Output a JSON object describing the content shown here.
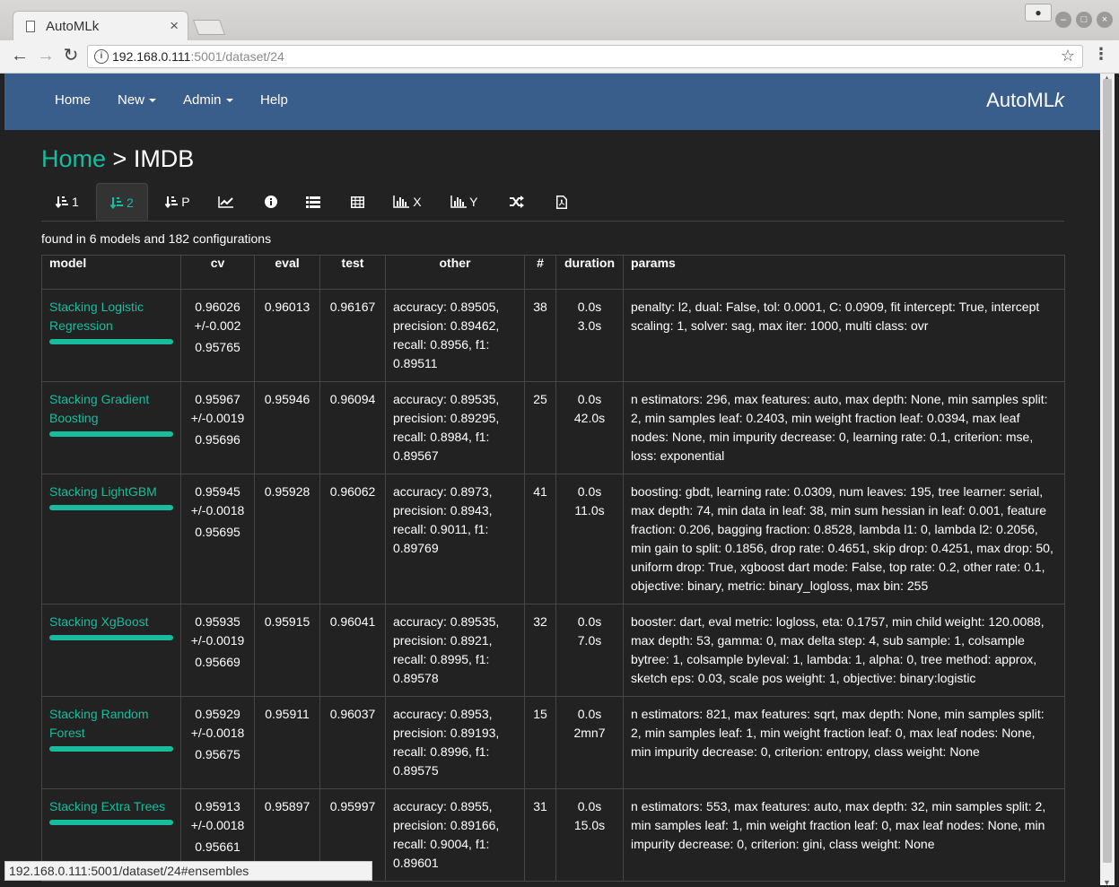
{
  "browser": {
    "tab_title": "AutoMLk",
    "tab_close": "×",
    "url_host": "192.168.0.111",
    "url_rest": ":5001/dataset/24",
    "status_url": "192.168.0.111:5001/dataset/24#ensembles",
    "back": "←",
    "forward": "→",
    "reload": "↻",
    "star": "☆",
    "menu": "⋮"
  },
  "navbar": {
    "items": [
      {
        "label": "Home"
      },
      {
        "label": "New"
      },
      {
        "label": "Admin"
      },
      {
        "label": "Help"
      }
    ],
    "brand_main": "AutoML",
    "brand_italic": "k"
  },
  "breadcrumb": {
    "home": "Home",
    "sep": " > ",
    "current": "IMDB"
  },
  "tabs": [
    {
      "icon": "sort-asc-icon",
      "label": "1"
    },
    {
      "icon": "sort-asc-icon",
      "label": "2",
      "active": true
    },
    {
      "icon": "sort-asc-icon",
      "label": "P"
    },
    {
      "icon": "line-chart-icon",
      "label": ""
    },
    {
      "icon": "info-icon",
      "label": ""
    },
    {
      "icon": "list-icon",
      "label": ""
    },
    {
      "icon": "table-icon",
      "label": ""
    },
    {
      "icon": "bar-chart-icon",
      "label": "X"
    },
    {
      "icon": "bar-chart-icon",
      "label": "Y"
    },
    {
      "icon": "shuffle-icon",
      "label": ""
    },
    {
      "icon": "pdf-icon",
      "label": ""
    }
  ],
  "found_text": "found in 6 models and 182 configurations",
  "table": {
    "headers": [
      "model",
      "cv",
      "eval",
      "test",
      "other",
      "#",
      "duration",
      "params"
    ],
    "rows": [
      {
        "model": "Stacking Logistic Regression",
        "cv": "0.96026",
        "cv_std": "+/-0.002",
        "cv_low": "0.95765",
        "eval": "0.96013",
        "test": "0.96167",
        "other": "accuracy: 0.89505, precision: 0.89462, recall: 0.8956, f1: 0.89511",
        "num": "38",
        "duration1": "0.0s",
        "duration2": "3.0s",
        "params": "penalty: l2, dual: False, tol: 0.0001, C: 0.0909, fit intercept: True, intercept scaling: 1, solver: sag, max iter: 1000, multi class: ovr"
      },
      {
        "model": "Stacking Gradient Boosting",
        "cv": "0.95967",
        "cv_std": "+/-0.0019",
        "cv_low": "0.95696",
        "eval": "0.95946",
        "test": "0.96094",
        "other": "accuracy: 0.89535, precision: 0.89295, recall: 0.8984, f1: 0.89567",
        "num": "25",
        "duration1": "0.0s",
        "duration2": "42.0s",
        "params": "n estimators: 296, max features: auto, max depth: None, min samples split: 2, min samples leaf: 0.2403, min weight fraction leaf: 0.0394, max leaf nodes: None, min impurity decrease: 0, learning rate: 0.1, criterion: mse, loss: exponential"
      },
      {
        "model": "Stacking LightGBM",
        "cv": "0.95945",
        "cv_std": "+/-0.0018",
        "cv_low": "0.95695",
        "eval": "0.95928",
        "test": "0.96062",
        "other": "accuracy: 0.8973, precision: 0.8943, recall: 0.9011, f1: 0.89769",
        "num": "41",
        "duration1": "0.0s",
        "duration2": "11.0s",
        "params": "boosting: gbdt, learning rate: 0.0309, num leaves: 195, tree learner: serial, max depth: 74, min data in leaf: 38, min sum hessian in leaf: 0.001, feature fraction: 0.206, bagging fraction: 0.8528, lambda l1: 0, lambda l2: 0.2056, min gain to split: 0.1856, drop rate: 0.4651, skip drop: 0.4251, max drop: 50, uniform drop: True, xgboost dart mode: False, top rate: 0.2, other rate: 0.1, objective: binary, metric: binary_logloss, max bin: 255"
      },
      {
        "model": "Stacking XgBoost",
        "cv": "0.95935",
        "cv_std": "+/-0.0019",
        "cv_low": "0.95669",
        "eval": "0.95915",
        "test": "0.96041",
        "other": "accuracy: 0.89535, precision: 0.8921, recall: 0.8995, f1: 0.89578",
        "num": "32",
        "duration1": "0.0s",
        "duration2": "7.0s",
        "params": "booster: dart, eval metric: logloss, eta: 0.1757, min child weight: 120.0088, max depth: 53, gamma: 0, max delta step: 4, sub sample: 1, colsample bytree: 1, colsample byleval: 1, lambda: 1, alpha: 0, tree method: approx, sketch eps: 0.03, scale pos weight: 1, objective: binary:logistic"
      },
      {
        "model": "Stacking Random Forest",
        "cv": "0.95929",
        "cv_std": "+/-0.0018",
        "cv_low": "0.95675",
        "eval": "0.95911",
        "test": "0.96037",
        "other": "accuracy: 0.8953, precision: 0.89193, recall: 0.8996, f1: 0.89575",
        "num": "15",
        "duration1": "0.0s",
        "duration2": "2mn7",
        "params": "n estimators: 821, max features: sqrt, max depth: None, min samples split: 2, min samples leaf: 1, min weight fraction leaf: 0, max leaf nodes: None, min impurity decrease: 0, criterion: entropy, class weight: None"
      },
      {
        "model": "Stacking Extra Trees",
        "cv": "0.95913",
        "cv_std": "+/-0.0018",
        "cv_low": "0.95661",
        "eval": "0.95897",
        "test": "0.95997",
        "other": "accuracy: 0.8955, precision: 0.89166, recall: 0.9004, f1: 0.89601",
        "num": "31",
        "duration1": "0.0s",
        "duration2": "15.0s",
        "params": "n estimators: 553, max features: auto, max depth: 32, min samples split: 2, min samples leaf: 1, min weight fraction leaf: 0, max leaf nodes: None, min impurity decrease: 0, criterion: gini, class weight: None"
      }
    ]
  },
  "colors": {
    "accent": "#18bc9c",
    "navbar": "#3a5e8c",
    "background": "#222222"
  }
}
